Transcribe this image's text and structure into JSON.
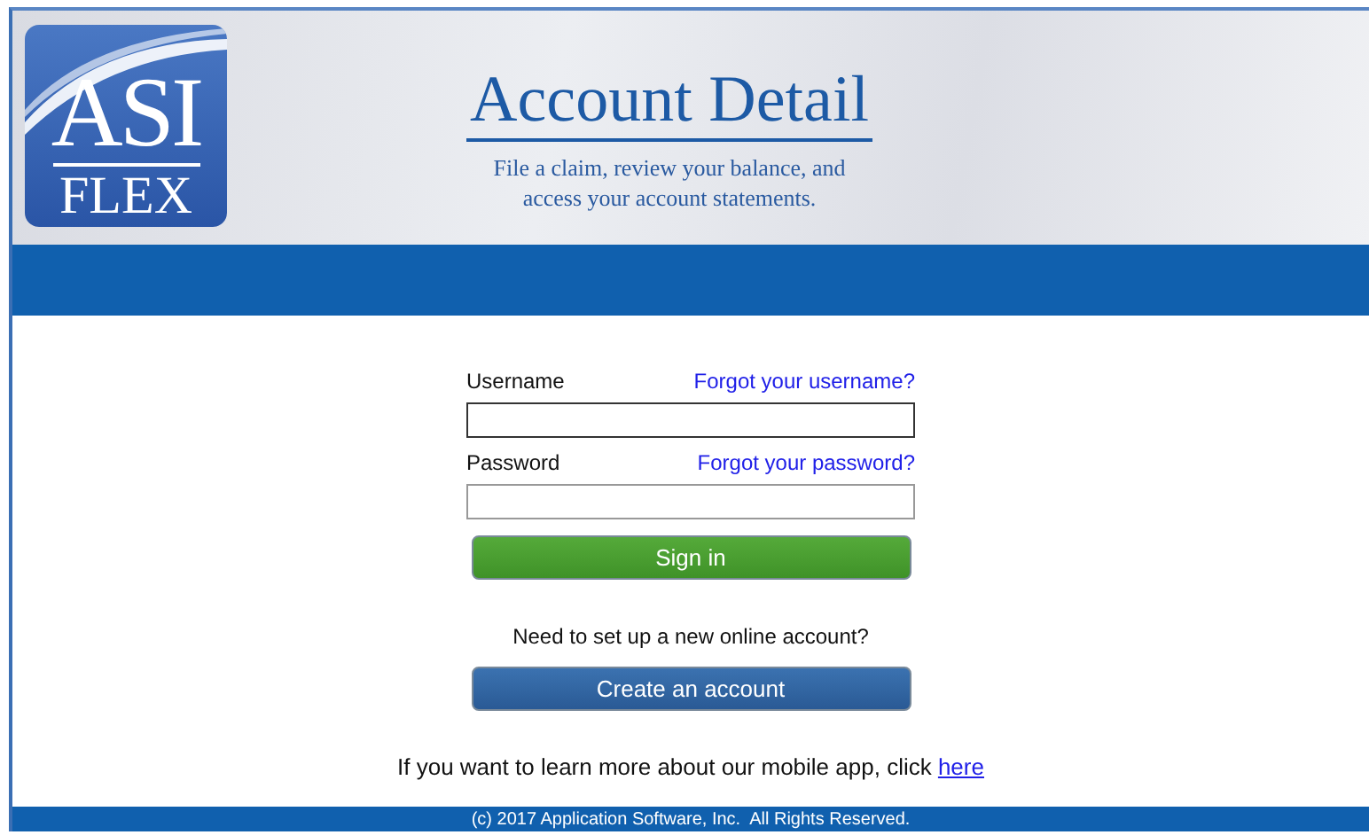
{
  "logo": {
    "top": "ASI",
    "bottom": "FLEX"
  },
  "header": {
    "title": "Account Detail",
    "subtitle_lines": [
      "File a claim, review your balance, and",
      "access your account statements."
    ]
  },
  "login": {
    "username_label": "Username",
    "forgot_username": "Forgot your username?",
    "password_label": "Password",
    "forgot_password": "Forgot your password?",
    "sign_in": "Sign in",
    "new_account_prompt": "Need to set up a new online account?",
    "create_account": "Create an account"
  },
  "mobile": {
    "text": "If you want to learn more about our mobile app, click",
    "link": "here"
  },
  "footer": "(c) 2017 Application Software, Inc.  All Rights Reserved."
}
